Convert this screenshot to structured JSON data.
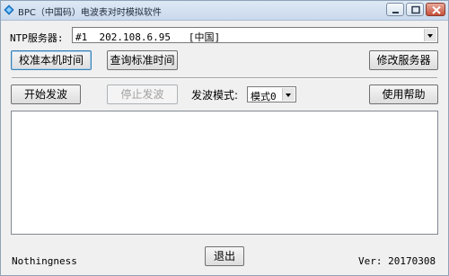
{
  "window": {
    "title": "BPC（中国码）电波表对时模拟软件",
    "app_icon": "diamond-app-icon"
  },
  "ntp": {
    "label": "NTP服务器:",
    "selected": "#1  202.108.6.95   [中国]"
  },
  "buttons": {
    "calibrate": "校准本机时间",
    "query": "查询标准时间",
    "modify_server": "修改服务器",
    "start": "开始发波",
    "stop": "停止发波",
    "help": "使用帮助",
    "exit": "退出"
  },
  "mode": {
    "label": "发波模式:",
    "selected": "模式0"
  },
  "output": {
    "text": ""
  },
  "footer": {
    "author": "Nothingness",
    "version": "Ver: 20170308"
  },
  "colors": {
    "accent": "#1e90ff"
  }
}
